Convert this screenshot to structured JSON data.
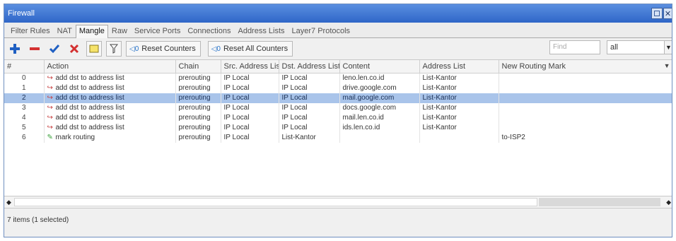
{
  "window": {
    "title": "Firewall"
  },
  "tabs": [
    {
      "label": "Filter Rules",
      "active": false
    },
    {
      "label": "NAT",
      "active": false
    },
    {
      "label": "Mangle",
      "active": true
    },
    {
      "label": "Raw",
      "active": false
    },
    {
      "label": "Service Ports",
      "active": false
    },
    {
      "label": "Connections",
      "active": false
    },
    {
      "label": "Address Lists",
      "active": false
    },
    {
      "label": "Layer7 Protocols",
      "active": false
    }
  ],
  "toolbar": {
    "add_icon": "plus-icon",
    "remove_icon": "minus-icon",
    "enable_icon": "check-icon",
    "disable_icon": "x-icon",
    "comment_icon": "note-icon",
    "filter_icon": "funnel-icon",
    "reset_counters": "Reset Counters",
    "reset_all_counters": "Reset All Counters",
    "find_placeholder": "Find",
    "filter_value": "all"
  },
  "table": {
    "columns": [
      "#",
      "Action",
      "Chain",
      "Src. Address List",
      "Dst. Address List",
      "Content",
      "Address List",
      "New Routing Mark"
    ],
    "rows": [
      {
        "num": "0",
        "action": "add dst to address list",
        "chain": "prerouting",
        "src": "IP Local",
        "dst": "IP Local",
        "content": "leno.len.co.id",
        "addr": "List-Kantor",
        "mark": "",
        "selected": false
      },
      {
        "num": "1",
        "action": "add dst to address list",
        "chain": "prerouting",
        "src": "IP Local",
        "dst": "IP Local",
        "content": "drive.google.com",
        "addr": "List-Kantor",
        "mark": "",
        "selected": false
      },
      {
        "num": "2",
        "action": "add dst to address list",
        "chain": "prerouting",
        "src": "IP Local",
        "dst": "IP Local",
        "content": "mail.google.com",
        "addr": "List-Kantor",
        "mark": "",
        "selected": true
      },
      {
        "num": "3",
        "action": "add dst to address list",
        "chain": "prerouting",
        "src": "IP Local",
        "dst": "IP Local",
        "content": "docs.google.com",
        "addr": "List-Kantor",
        "mark": "",
        "selected": false
      },
      {
        "num": "4",
        "action": "add dst to address list",
        "chain": "prerouting",
        "src": "IP Local",
        "dst": "IP Local",
        "content": "mail.len.co.id",
        "addr": "List-Kantor",
        "mark": "",
        "selected": false
      },
      {
        "num": "5",
        "action": "add dst to address list",
        "chain": "prerouting",
        "src": "IP Local",
        "dst": "IP Local",
        "content": "ids.len.co.id",
        "addr": "List-Kantor",
        "mark": "",
        "selected": false
      },
      {
        "num": "6",
        "action": "mark routing",
        "chain": "prerouting",
        "src": "IP Local",
        "dst": "List-Kantor",
        "content": "",
        "addr": "",
        "mark": "to-ISP2",
        "selected": false
      }
    ]
  },
  "status": {
    "text": "7 items (1 selected)"
  }
}
